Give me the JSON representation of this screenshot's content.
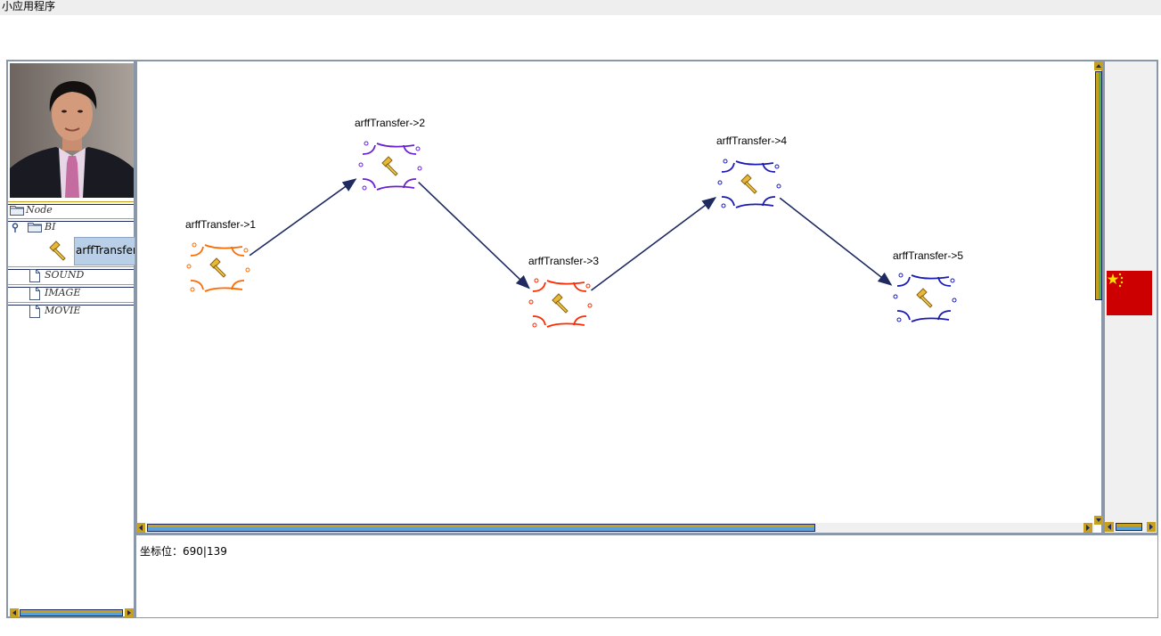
{
  "window": {
    "title": "小应用程序"
  },
  "tree": {
    "items": [
      {
        "label": "Node",
        "icon": "folder-icon"
      },
      {
        "label": "BI",
        "icon": "folder-icon"
      },
      {
        "label": "arffTransfer",
        "icon": "hammer-icon",
        "selected": true
      },
      {
        "label": "SOUND",
        "icon": "document-icon"
      },
      {
        "label": "IMAGE",
        "icon": "document-icon"
      },
      {
        "label": "MOVIE",
        "icon": "document-icon"
      }
    ]
  },
  "canvas": {
    "nodes": [
      {
        "label": "arffTransfer->1",
        "color": "#ff6a00"
      },
      {
        "label": "arffTransfer->2",
        "color": "#6a1fd6"
      },
      {
        "label": "arffTransfer->3",
        "color": "#ff2a00"
      },
      {
        "label": "arffTransfer->4",
        "color": "#1a1ab8"
      },
      {
        "label": "arffTransfer->5",
        "color": "#1a1ab8"
      }
    ],
    "edge_color": "#1e2a60",
    "edges": [
      [
        1,
        2
      ],
      [
        2,
        3
      ],
      [
        3,
        4
      ],
      [
        4,
        5
      ]
    ]
  },
  "status": {
    "coordinates_text": "坐标位：690|139"
  },
  "colors": {
    "border": "#8a97a8",
    "scroll_gold": "#c8a020",
    "scroll_blue": "#1e2a60",
    "flag_red": "#cc0000",
    "flag_star": "#ffdd00"
  }
}
